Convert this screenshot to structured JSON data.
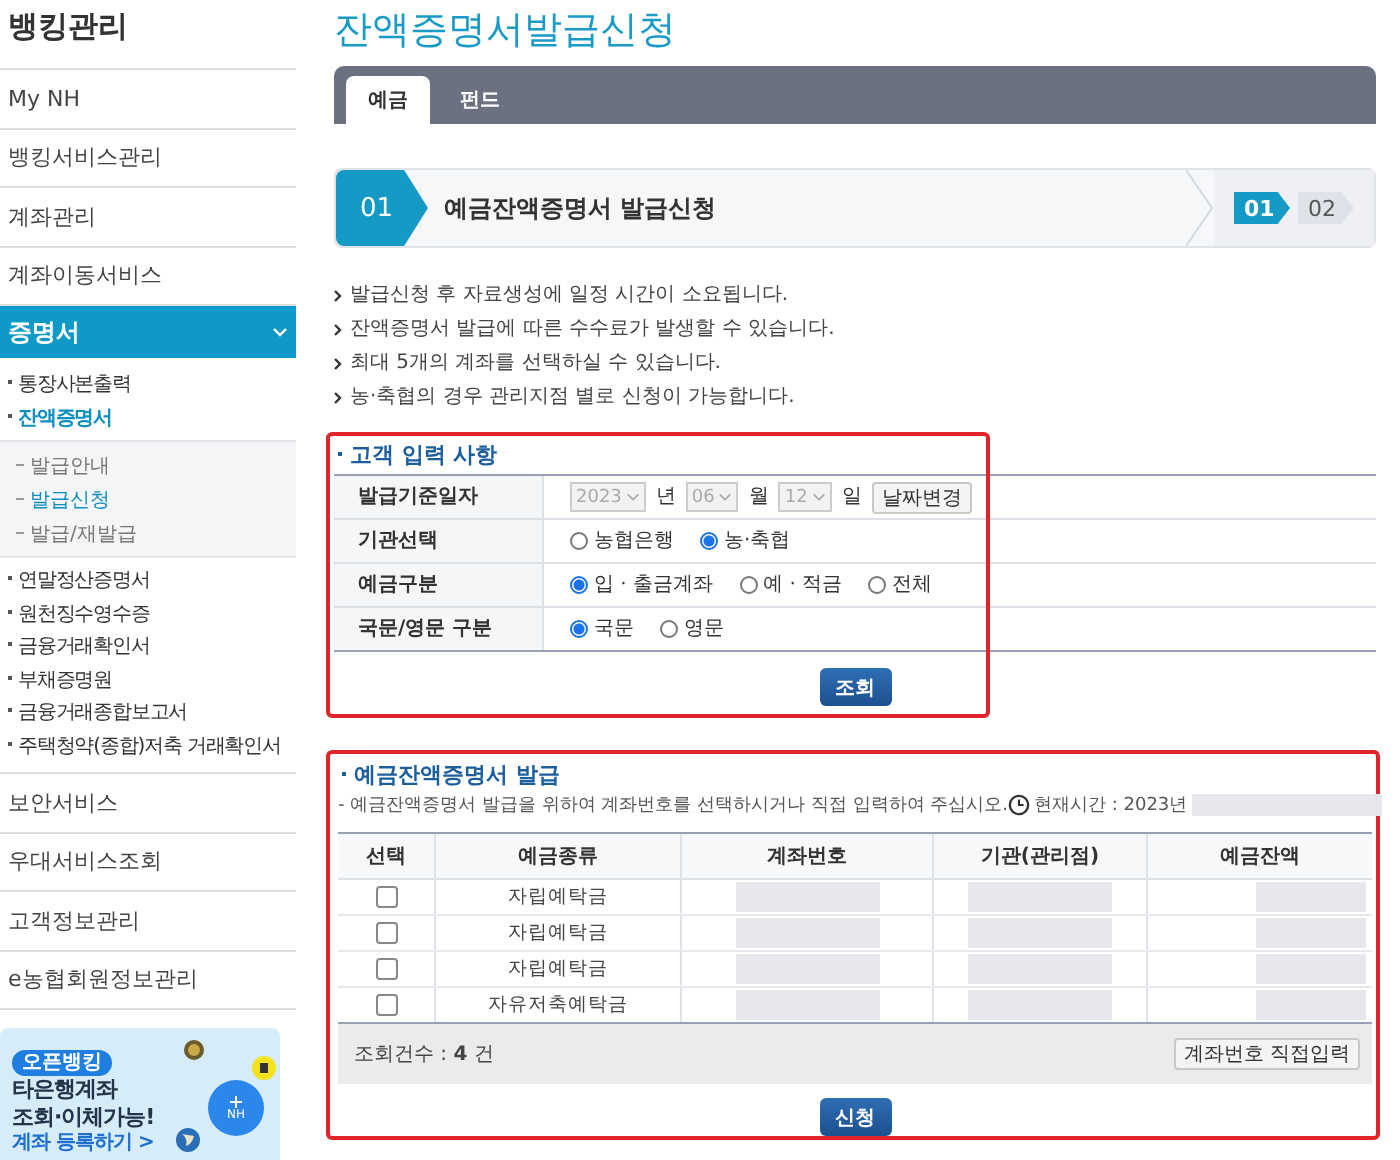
{
  "sidebar": {
    "title": "뱅킹관리",
    "items": [
      {
        "label": "My NH",
        "selected": false
      },
      {
        "label": "뱅킹서비스관리",
        "selected": false
      },
      {
        "label": "계좌관리",
        "selected": false
      },
      {
        "label": "계좌이동서비스",
        "selected": false
      },
      {
        "label": "증명서",
        "selected": true,
        "expanded": true,
        "children": [
          {
            "label": "통장사본출력",
            "selected": false
          },
          {
            "label": "잔액증명서",
            "selected": true,
            "children": [
              {
                "label": "발급안내",
                "selected": false
              },
              {
                "label": "발급신청",
                "selected": true
              },
              {
                "label": "발급/재발급",
                "selected": false
              }
            ]
          },
          {
            "label": "연말정산증명서",
            "selected": false
          },
          {
            "label": "원천징수영수증",
            "selected": false
          },
          {
            "label": "금융거래확인서",
            "selected": false
          },
          {
            "label": "부채증명원",
            "selected": false
          },
          {
            "label": "금융거래종합보고서",
            "selected": false
          },
          {
            "label": "주택청약(종합)저축 거래확인서",
            "selected": false
          }
        ]
      },
      {
        "label": "보안서비스",
        "selected": false
      },
      {
        "label": "우대서비스조회",
        "selected": false
      },
      {
        "label": "고객정보관리",
        "selected": false
      },
      {
        "label": "e농협회원정보관리",
        "selected": false
      }
    ],
    "banner": {
      "badge": "오픈뱅킹",
      "headline": [
        "타은행계좌",
        "조회·이체가능!"
      ],
      "link": "계좌 등록하기 >",
      "fab_label": "NH"
    }
  },
  "page_title": "잔액증명서발급신청",
  "tabs": [
    {
      "label": "예금",
      "selected": true
    },
    {
      "label": "펀드",
      "selected": false
    }
  ],
  "step": {
    "number": "01",
    "title": "예금잔액증명서 발급신청",
    "steps": [
      {
        "label": "01",
        "selected": true
      },
      {
        "label": "02",
        "selected": false
      }
    ]
  },
  "notes": [
    "발급신청 후 자료생성에 일정 시간이 소요됩니다.",
    "잔액증명서 발급에 따른 수수료가 발생할 수 있습니다.",
    "최대 5개의 계좌를 선택하실 수 있습니다.",
    "농·축협의 경우 관리지점 별로 신청이 가능합니다."
  ],
  "customer_input": {
    "heading": "고객 입력 사항",
    "rows": [
      {
        "kind": "date",
        "label": "발급기준일자",
        "disabled": true,
        "year": "2023",
        "year_unit": "년",
        "month": "06",
        "month_unit": "월",
        "day": "12",
        "day_unit": "일",
        "button": "날짜변경"
      },
      {
        "kind": "radio",
        "label": "기관선택",
        "options": [
          {
            "label": "농협은행",
            "selected": false
          },
          {
            "label": "농·축협",
            "selected": true
          }
        ]
      },
      {
        "kind": "radio",
        "label": "예금구분",
        "options": [
          {
            "label": "입 · 출금계좌",
            "selected": true
          },
          {
            "label": "예 · 적금",
            "selected": false
          },
          {
            "label": "전체",
            "selected": false
          }
        ]
      },
      {
        "kind": "radio",
        "label": "국문/영문 구분",
        "options": [
          {
            "label": "국문",
            "selected": true
          },
          {
            "label": "영문",
            "selected": false
          }
        ]
      }
    ],
    "button": "조회"
  },
  "issue": {
    "heading": "예금잔액증명서 발급",
    "description": "- 예금잔액증명서 발급을 위하여 계좌번호를 선택하시거나 직접 입력하여 주십시오.",
    "time_label": "현재시간 : 2023년",
    "columns": [
      "선택",
      "예금종류",
      "계좌번호",
      "기관(관리점)",
      "예금잔액"
    ],
    "rows": [
      {
        "checked": false,
        "type": "자립예탁금"
      },
      {
        "checked": false,
        "type": "자립예탁금"
      },
      {
        "checked": false,
        "type": "자립예탁금"
      },
      {
        "checked": false,
        "type": "자유저축예탁금"
      }
    ],
    "count": "조회건수 : **4** 건",
    "direct_input_button": "계좌번호 직접입력",
    "submit": "신청"
  }
}
